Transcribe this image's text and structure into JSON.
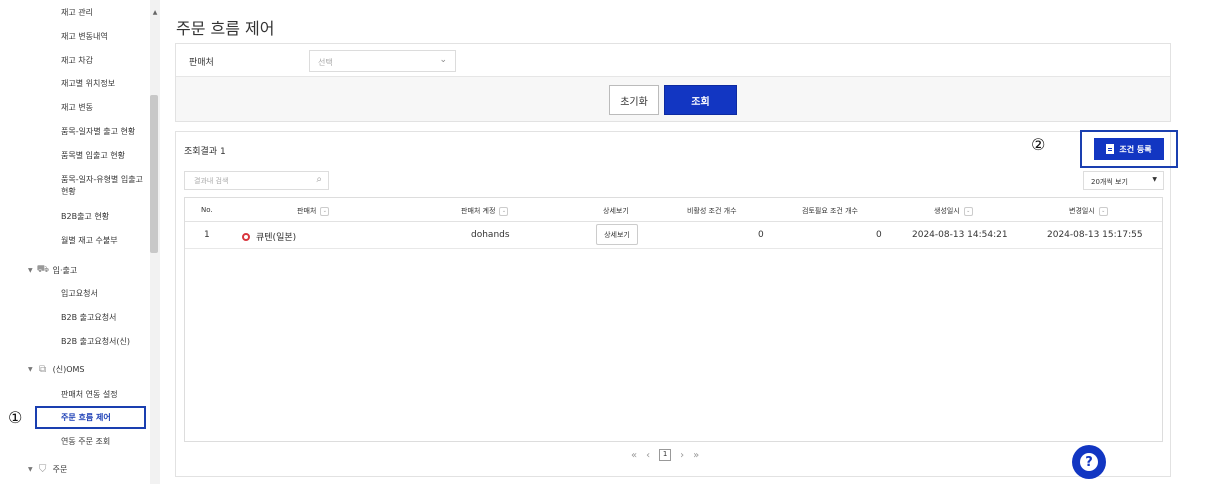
{
  "sidebar": {
    "items": [
      {
        "label": "재고 관리"
      },
      {
        "label": "재고 변동내역"
      },
      {
        "label": "재고 차감"
      },
      {
        "label": "재고별 위치정보"
      },
      {
        "label": "재고 변동"
      },
      {
        "label": "품목-일자별 출고 현황"
      },
      {
        "label": "품목별 입출고 현황"
      },
      {
        "label": "품목-일자-유형별 입출고 현황"
      },
      {
        "label": "B2B출고 현황"
      },
      {
        "label": "월별 재고 수불부"
      }
    ],
    "group_inout": {
      "label": "입·출고",
      "items": [
        {
          "label": "입고요청서"
        },
        {
          "label": "B2B 출고요청서"
        },
        {
          "label": "B2B 출고요청서(신)"
        }
      ]
    },
    "group_oms": {
      "label": "(신)OMS",
      "items": [
        {
          "label": "판매처 연동 설정"
        },
        {
          "label": "주문 흐름 제어"
        },
        {
          "label": "연동 주문 조회"
        }
      ]
    },
    "group_order": {
      "label": "주문"
    },
    "marker": "①"
  },
  "page": {
    "title": "주문 흐름 제어"
  },
  "filter": {
    "seller_label": "판매처",
    "seller_placeholder": "선택",
    "reset_label": "초기화",
    "search_label": "조회"
  },
  "result": {
    "count_label": "조회결과 1",
    "register_label": "조건 등록",
    "marker": "②",
    "search_placeholder": "결과내 검색",
    "page_size": "20개씩 보기",
    "columns": {
      "no": "No.",
      "seller": "판매처",
      "seller_account": "판매처 계정",
      "detail": "상세보기",
      "inactive_count": "비활성 조건 개수",
      "review_count": "검토필요 조건 개수",
      "created": "생성일시",
      "modified": "변경일시"
    },
    "rows": [
      {
        "no": "1",
        "seller": "큐텐(일본)",
        "seller_account": "dohands",
        "detail": "상세보기",
        "inactive_count": "0",
        "review_count": "0",
        "created": "2024-08-13 14:54:21",
        "modified": "2024-08-13 15:17:55"
      }
    ],
    "current_page": "1"
  },
  "colors": {
    "primary": "#1236c2",
    "highlight": "#1a3fb0",
    "qoo10": "#d9363e"
  }
}
